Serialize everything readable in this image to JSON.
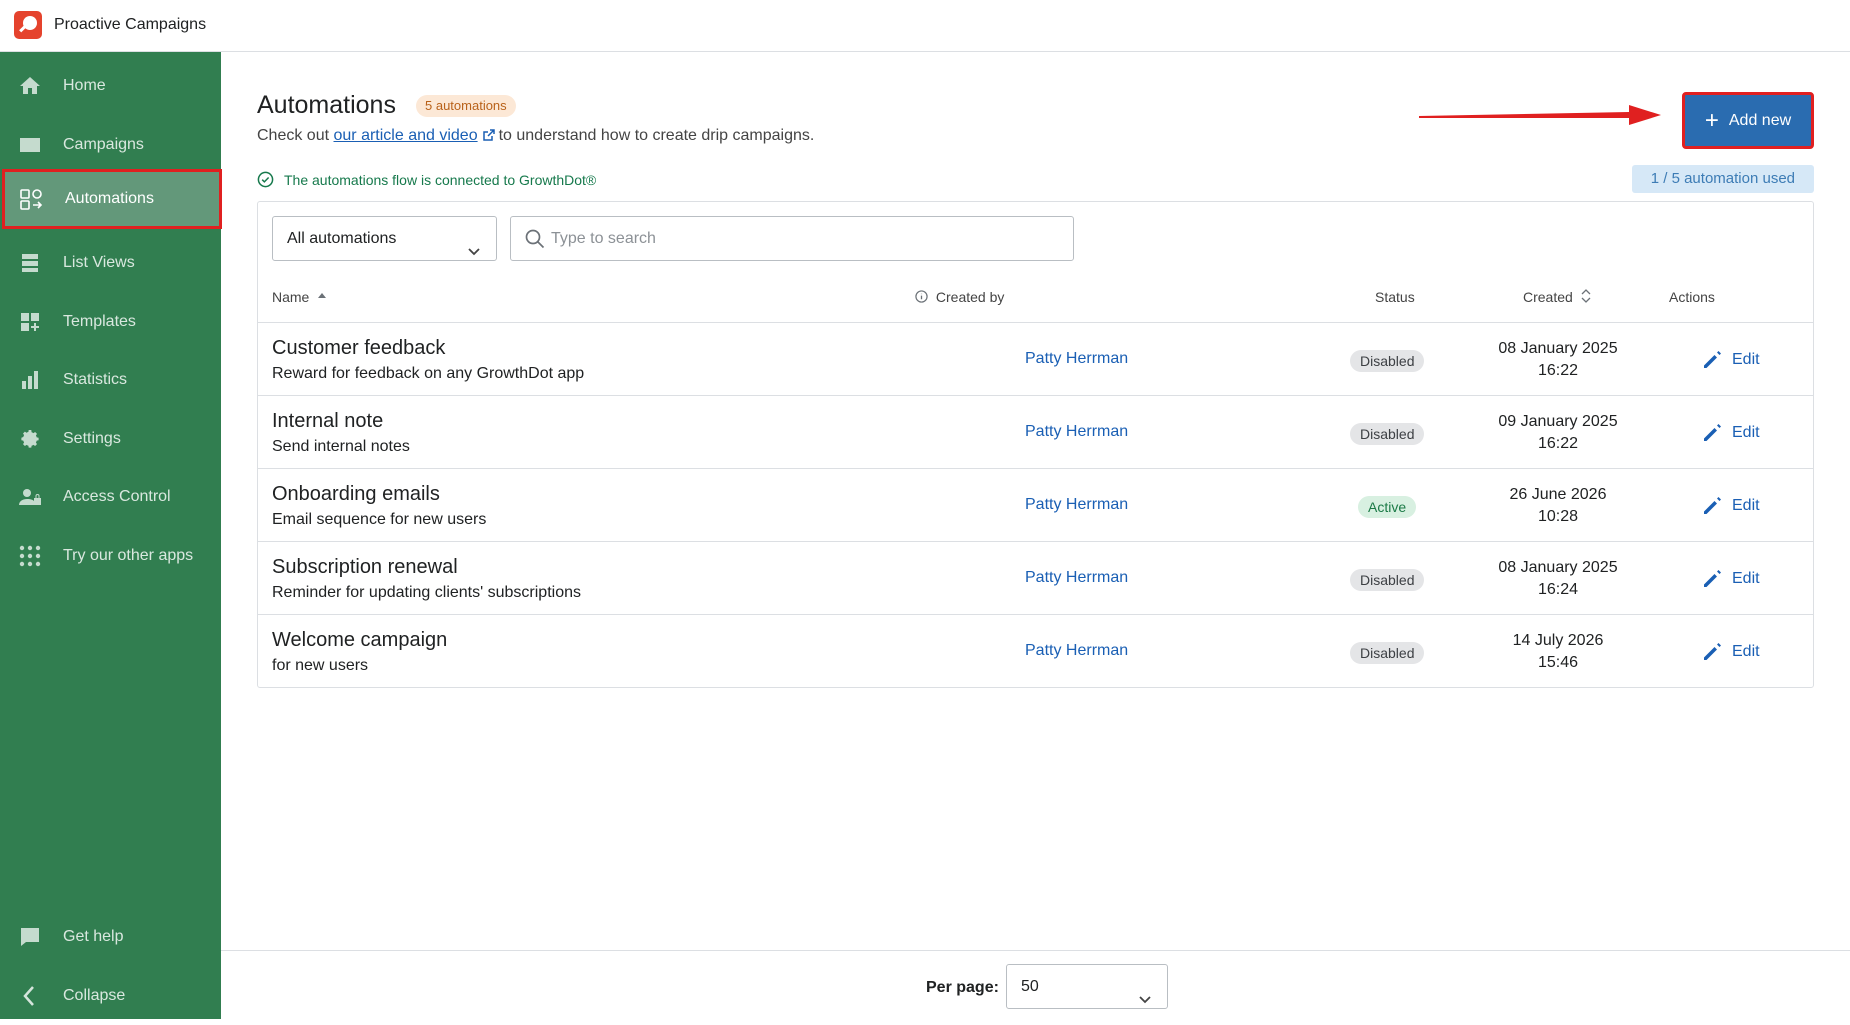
{
  "app": {
    "name": "Proactive Campaigns"
  },
  "sidebar": {
    "items": [
      {
        "label": "Home",
        "icon": "home-icon"
      },
      {
        "label": "Campaigns",
        "icon": "envelope-icon"
      },
      {
        "label": "Automations",
        "icon": "automation-icon",
        "active": true
      },
      {
        "label": "List Views",
        "icon": "list-icon"
      },
      {
        "label": "Templates",
        "icon": "templates-icon"
      },
      {
        "label": "Statistics",
        "icon": "bar-chart-icon"
      },
      {
        "label": "Settings",
        "icon": "gear-icon"
      },
      {
        "label": "Access Control",
        "icon": "user-lock-icon"
      },
      {
        "label": "Try our other apps",
        "icon": "apps-grid-icon"
      }
    ],
    "bottom": [
      {
        "label": "Get help",
        "icon": "chat-icon"
      },
      {
        "label": "Collapse",
        "icon": "chevron-left-icon"
      }
    ]
  },
  "header": {
    "title": "Automations",
    "count_badge": "5 automations",
    "subtitle_pre": "Check out",
    "subtitle_link": "our article and video",
    "subtitle_post": "to understand how to create drip campaigns.",
    "connected": "The automations flow is connected to GrowthDot®",
    "usage": "1 / 5 automation used",
    "add_new": "Add new"
  },
  "filters": {
    "select_value": "All automations",
    "search_placeholder": "Type to search"
  },
  "table": {
    "columns": {
      "name": "Name",
      "created_by": "Created by",
      "status": "Status",
      "created": "Created",
      "actions": "Actions"
    },
    "rows": [
      {
        "name": "Customer feedback",
        "desc": "Reward for feedback on any GrowthDot app",
        "creator": "Patty Herrman",
        "status": "Disabled",
        "date": "08 January 2025",
        "time": "16:22",
        "action": "Edit"
      },
      {
        "name": "Internal note",
        "desc": "Send internal notes",
        "creator": "Patty Herrman",
        "status": "Disabled",
        "date": "09 January 2025",
        "time": "16:22",
        "action": "Edit"
      },
      {
        "name": "Onboarding emails",
        "desc": "Email sequence for new users",
        "creator": "Patty Herrman",
        "status": "Active",
        "date": "26 June 2026",
        "time": "10:28",
        "action": "Edit"
      },
      {
        "name": "Subscription renewal",
        "desc": "Reminder for updating clients' subscriptions",
        "creator": "Patty Herrman",
        "status": "Disabled",
        "date": "08 January 2025",
        "time": "16:24",
        "action": "Edit"
      },
      {
        "name": "Welcome campaign",
        "desc": "for new users",
        "creator": "Patty Herrman",
        "status": "Disabled",
        "date": "14 July 2026",
        "time": "15:46",
        "action": "Edit"
      }
    ]
  },
  "footer": {
    "per_page_label": "Per page:",
    "per_page_value": "50"
  },
  "colors": {
    "sidebar": "#317e50",
    "primary": "#2a6cb0",
    "highlight": "#e02020"
  }
}
